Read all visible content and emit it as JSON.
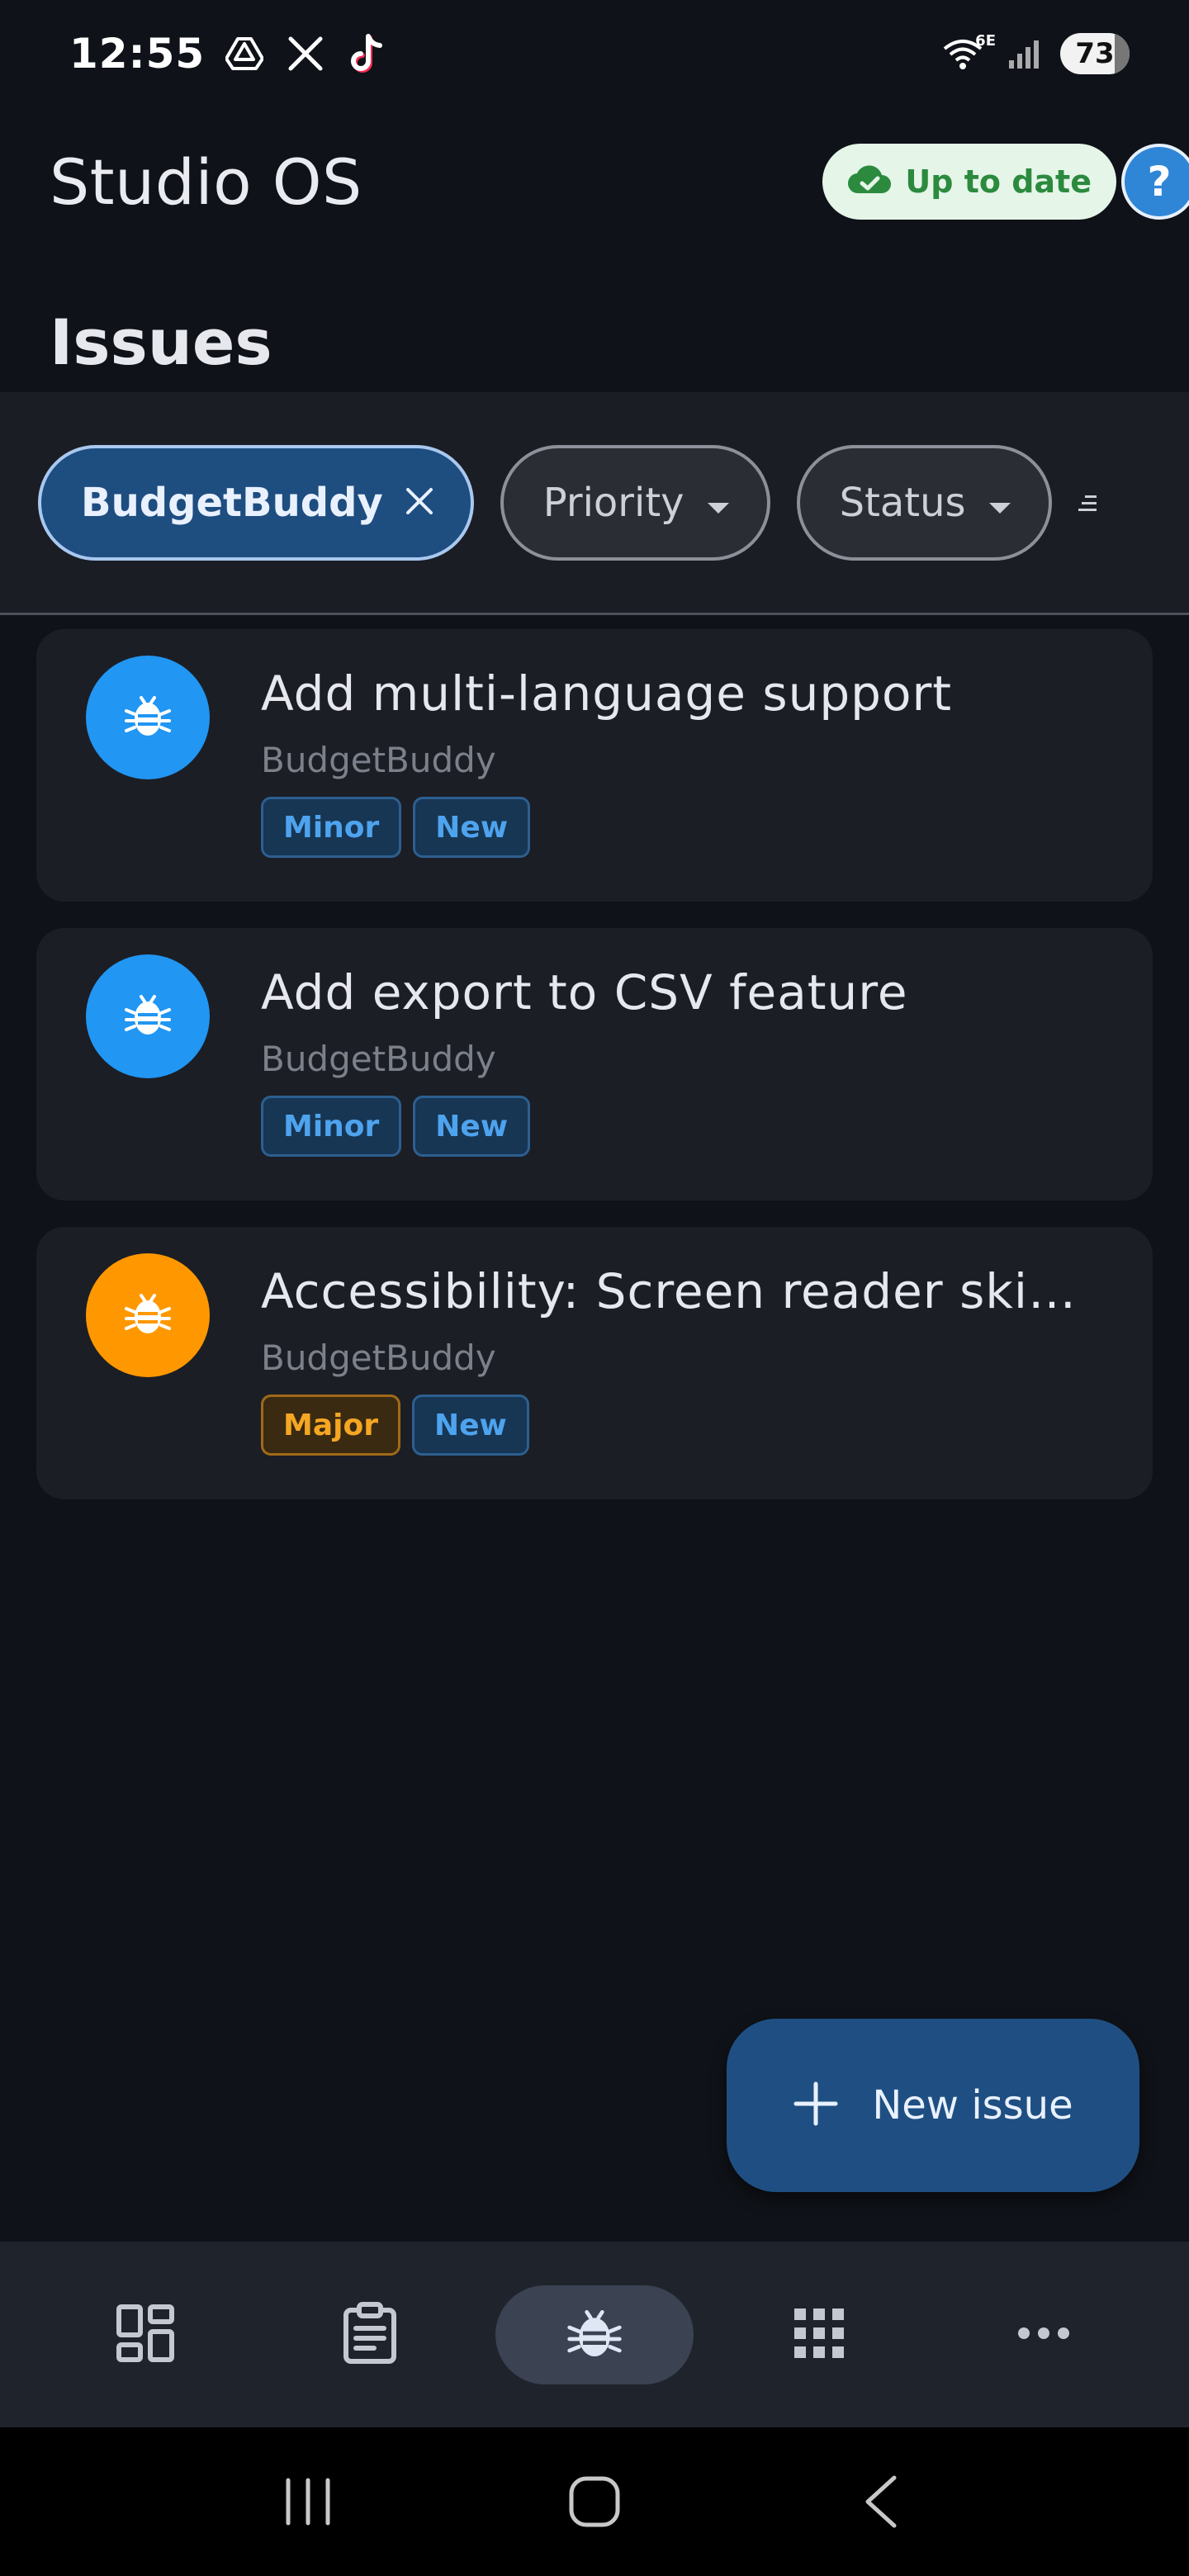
{
  "status_bar": {
    "time": "12:55",
    "network_label": "6E",
    "battery": "73",
    "icons": [
      "drive-icon",
      "x-icon",
      "tiktok-icon",
      "wifi-icon",
      "signal-icon",
      "battery-icon"
    ]
  },
  "app_bar": {
    "title": "Studio OS",
    "sync_status": "Up to date",
    "help_label": "?"
  },
  "page": {
    "heading": "Issues"
  },
  "filters": {
    "project_chip": "BudgetBuddy",
    "priority_chip": "Priority",
    "status_chip": "Status"
  },
  "issues": [
    {
      "title": "Add multi-language support",
      "project": "BudgetBuddy",
      "severity": "Minor",
      "state": "New",
      "avatar_color": "#2196f3"
    },
    {
      "title": "Add export to CSV feature",
      "project": "BudgetBuddy",
      "severity": "Minor",
      "state": "New",
      "avatar_color": "#2196f3"
    },
    {
      "title": "Accessibility: Screen reader skip…",
      "project": "BudgetBuddy",
      "severity": "Major",
      "state": "New",
      "avatar_color": "#ff9800"
    }
  ],
  "fab": {
    "label": "New issue"
  },
  "bottom_nav": {
    "items": [
      "dashboard-icon",
      "clipboard-icon",
      "bug-icon",
      "apps-grid-icon",
      "more-icon"
    ],
    "active_index": 2
  },
  "colors": {
    "background": "#0f1218",
    "accent": "#1f4f82",
    "minor": "#4ea3ee",
    "major": "#f5a623",
    "sync_green": "#2b8a3e"
  }
}
